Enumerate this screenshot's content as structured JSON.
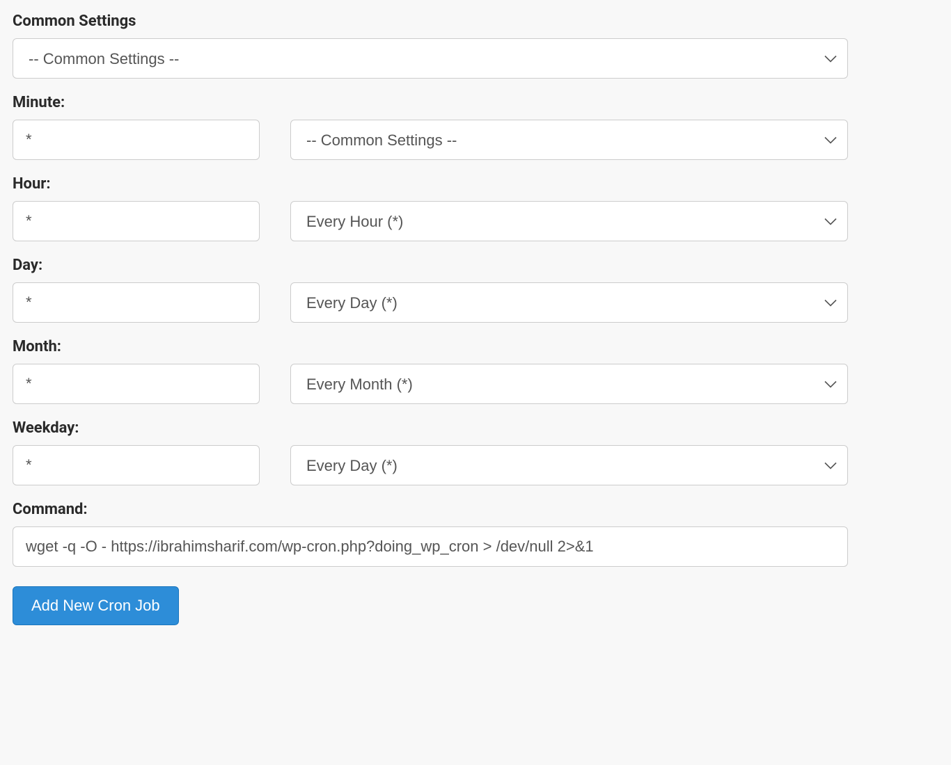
{
  "common_settings": {
    "label": "Common Settings",
    "selected": "-- Common Settings --"
  },
  "minute": {
    "label": "Minute:",
    "value": "*",
    "preset": "-- Common Settings --"
  },
  "hour": {
    "label": "Hour:",
    "value": "*",
    "preset": "Every Hour (*)"
  },
  "day": {
    "label": "Day:",
    "value": "*",
    "preset": "Every Day (*)"
  },
  "month": {
    "label": "Month:",
    "value": "*",
    "preset": "Every Month (*)"
  },
  "weekday": {
    "label": "Weekday:",
    "value": "*",
    "preset": "Every Day (*)"
  },
  "command": {
    "label": "Command:",
    "value": "wget -q -O - https://ibrahimsharif.com/wp-cron.php?doing_wp_cron > /dev/null 2>&1"
  },
  "submit": {
    "label": "Add New Cron Job"
  }
}
